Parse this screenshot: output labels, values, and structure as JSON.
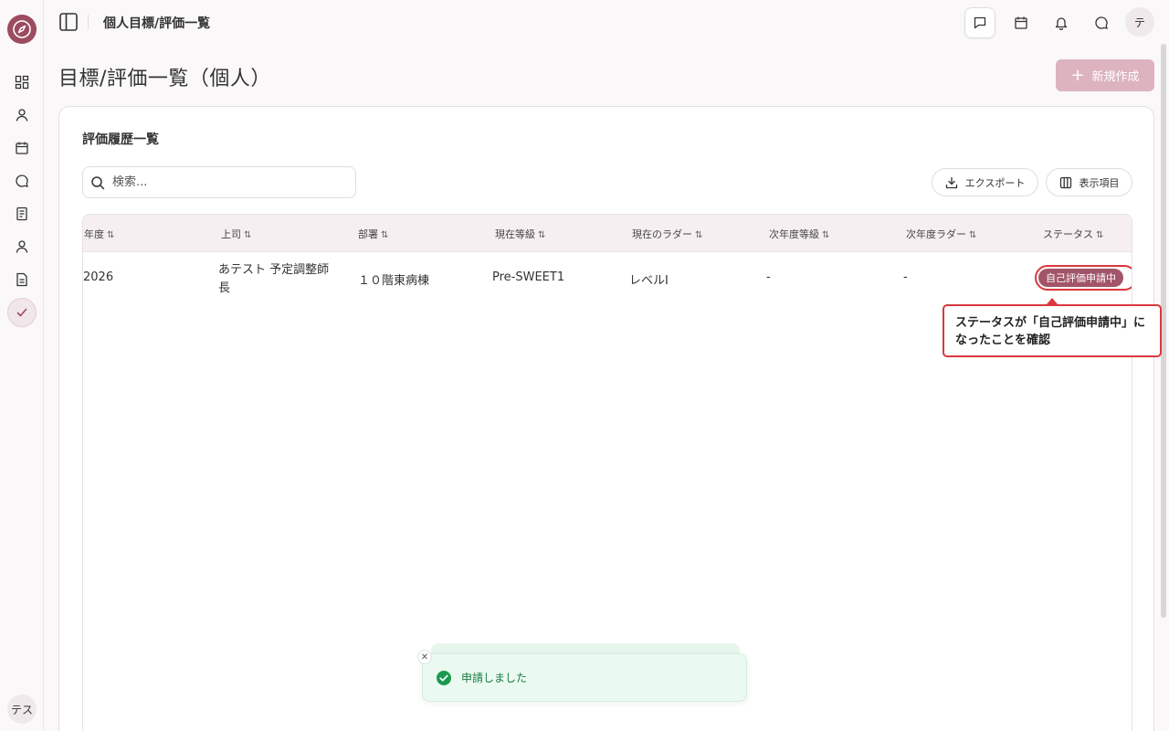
{
  "app": {
    "user_initials_sidebar": "テス",
    "user_initial_header": "テ"
  },
  "header": {
    "breadcrumb": "個人目標/評価一覧"
  },
  "page": {
    "title": "目標/評価一覧（個人）",
    "new_button_label": "新規作成"
  },
  "card": {
    "title": "評価履歴一覧",
    "search_placeholder": "検索...",
    "export_label": "エクスポート",
    "columns_label": "表示項目"
  },
  "table": {
    "headers": [
      "年度",
      "上司",
      "部署",
      "現在等級",
      "現在のラダー",
      "次年度等級",
      "次年度ラダー",
      "ステータス"
    ],
    "sort_glyph": "⇅",
    "row": {
      "year": "2026",
      "supervisor_line1": "あテスト 予定調整師",
      "supervisor_line2": "長",
      "department": "１０階東病棟",
      "current_grade": "Pre-SWEET1",
      "current_ladder": "レベルI",
      "next_grade": "-",
      "next_ladder": "-",
      "status": "自己評価申請中"
    }
  },
  "callout": {
    "line1": "ステータスが「自己評価申請中」に",
    "line2": "なったことを確認"
  },
  "toast": {
    "message": "申請しました"
  },
  "colors": {
    "brand": "#9c4b60",
    "status_badge": "#a25569",
    "highlight": "#d9383d",
    "toast_text": "#1c7a43"
  }
}
